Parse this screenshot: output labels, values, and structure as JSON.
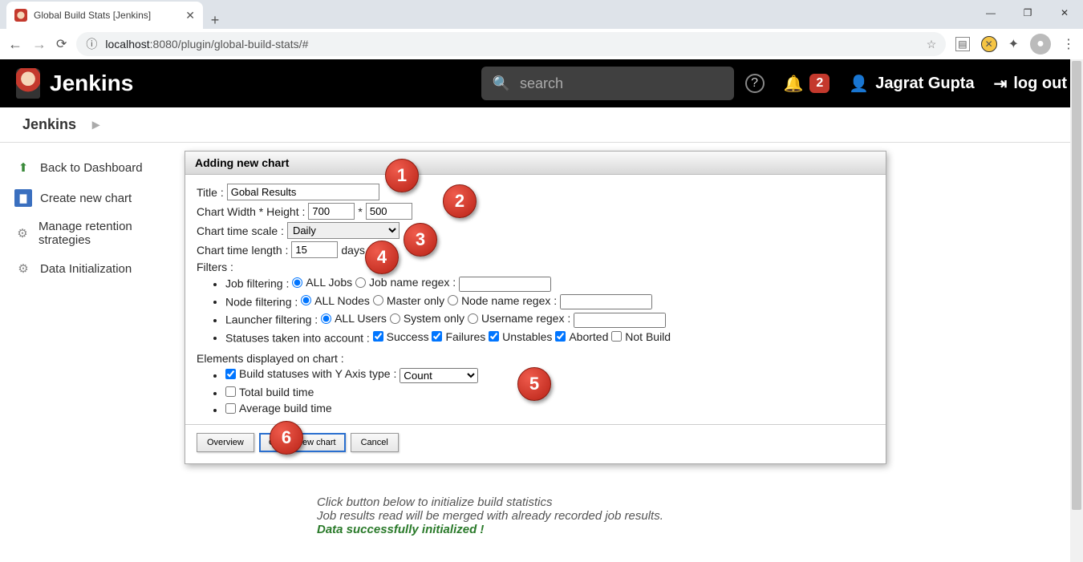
{
  "browser": {
    "tab_title": "Global Build Stats [Jenkins]",
    "url_host": "localhost",
    "url_port_path": ":8080/plugin/global-build-stats/#"
  },
  "win": {
    "min": "—",
    "max": "❐",
    "close": "✕"
  },
  "header": {
    "brand": "Jenkins",
    "search_placeholder": "search",
    "notif_count": "2",
    "user": "Jagrat Gupta",
    "logout": "log out"
  },
  "breadcrumb": {
    "root": "Jenkins"
  },
  "sidebar": {
    "items": [
      {
        "label": "Back to Dashboard"
      },
      {
        "label": "Create new chart"
      },
      {
        "label": "Manage retention strategies"
      },
      {
        "label": "Data Initialization"
      }
    ]
  },
  "dialog": {
    "title": "Adding new chart",
    "title_label": "Title :",
    "title_value": "Gobal Results",
    "wh_label": "Chart Width * Height :",
    "width": "700",
    "wh_sep": "*",
    "height": "500",
    "scale_label": "Chart time scale :",
    "scale_value": "Daily",
    "length_label": "Chart time length :",
    "length_value": "15",
    "length_unit": "days",
    "filters_label": "Filters :",
    "job_filter_label": "Job filtering :",
    "job_all": "ALL Jobs",
    "job_regex": "Job name regex :",
    "node_filter_label": "Node filtering :",
    "node_all": "ALL Nodes",
    "node_master": "Master only",
    "node_regex": "Node name regex :",
    "launcher_label": "Launcher filtering :",
    "launcher_all": "ALL Users",
    "launcher_system": "System only",
    "launcher_regex": "Username regex :",
    "statuses_label": "Statuses taken into account :",
    "s_success": "Success",
    "s_failures": "Failures",
    "s_unstables": "Unstables",
    "s_aborted": "Aborted",
    "s_notbuild": "Not Build",
    "elements_label": "Elements displayed on chart :",
    "el_build_statuses": "Build statuses with Y Axis type :",
    "el_yaxis": "Count",
    "el_total": "Total build time",
    "el_avg": "Average build time",
    "btn_overview": "Overview",
    "btn_create": "Create new chart",
    "btn_cancel": "Cancel"
  },
  "callouts": {
    "c1": "1",
    "c2": "2",
    "c3": "3",
    "c4": "4",
    "c5": "5",
    "c6": "6"
  },
  "below": {
    "line1": "Click button below to initialize build statistics",
    "line2": "Job results read will be merged with already recorded job results.",
    "line3": "Data successfully initialized !"
  }
}
